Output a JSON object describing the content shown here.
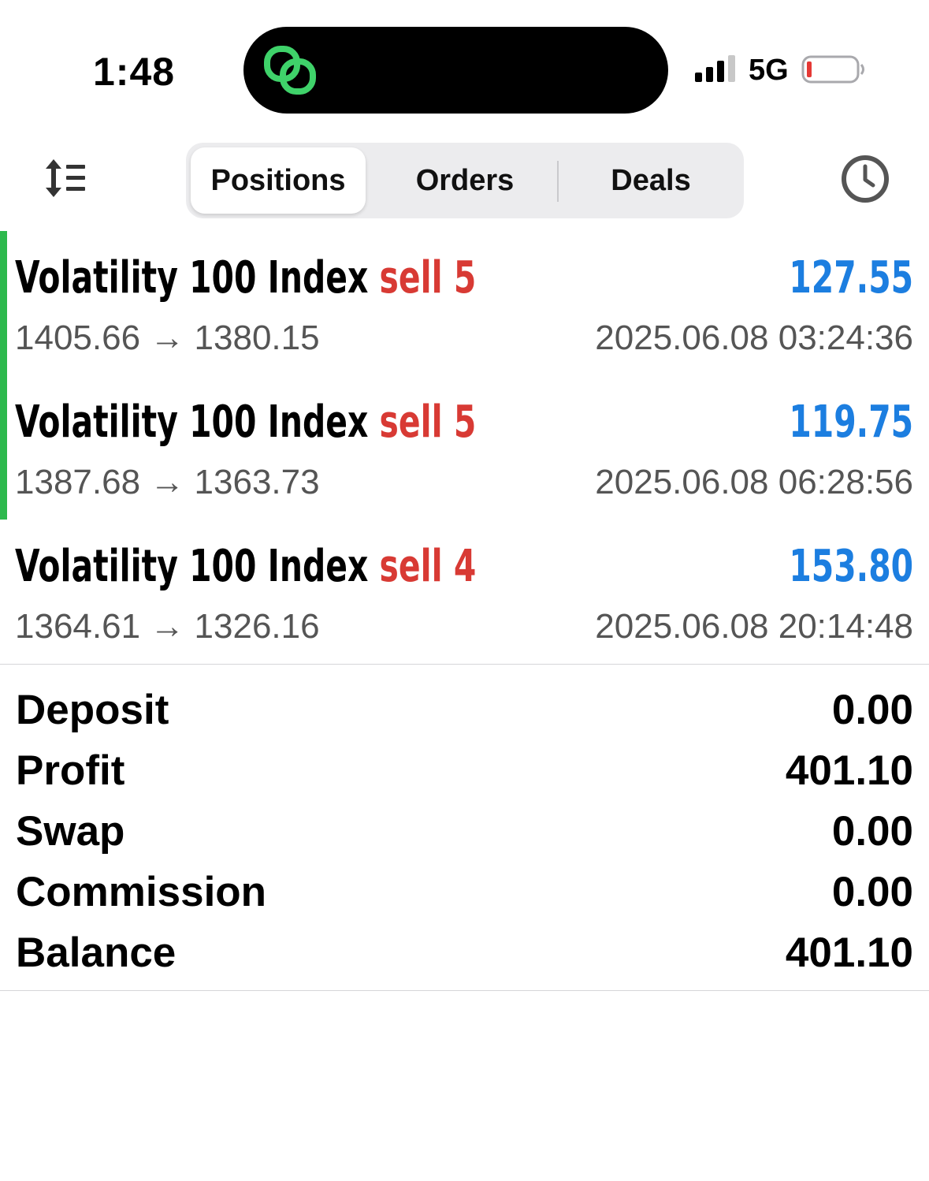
{
  "status_bar": {
    "time": "1:48",
    "network": "5G",
    "island_icon": "linked-rings-icon",
    "island_color": "#3fd26a",
    "battery_color": "#e53935"
  },
  "toolbar": {
    "sort_icon": "sort-icon",
    "history_icon": "clock-icon",
    "tabs": [
      {
        "label": "Positions",
        "active": true
      },
      {
        "label": "Orders",
        "active": false
      },
      {
        "label": "Deals",
        "active": false
      }
    ]
  },
  "positions": [
    {
      "symbol": "Volatility 100 Index",
      "side": "sell 5",
      "profit": "127.55",
      "open_price": "1405.66",
      "arrow": "→",
      "close_price": "1380.15",
      "datetime": "2025.06.08 03:24:36"
    },
    {
      "symbol": "Volatility 100 Index",
      "side": "sell 5",
      "profit": "119.75",
      "open_price": "1387.68",
      "arrow": "→",
      "close_price": "1363.73",
      "datetime": "2025.06.08 06:28:56"
    },
    {
      "symbol": "Volatility 100 Index",
      "side": "sell 4",
      "profit": "153.80",
      "open_price": "1364.61",
      "arrow": "→",
      "close_price": "1326.16",
      "datetime": "2025.06.08 20:14:48"
    }
  ],
  "summary": [
    {
      "label": "Deposit",
      "value": "0.00"
    },
    {
      "label": "Profit",
      "value": "401.10"
    },
    {
      "label": "Swap",
      "value": "0.00"
    },
    {
      "label": "Commission",
      "value": "0.00"
    },
    {
      "label": "Balance",
      "value": "401.10"
    }
  ],
  "colors": {
    "profit": "#1c7ee0",
    "sell": "#d83a34",
    "selected_marker": "#2db94d"
  }
}
